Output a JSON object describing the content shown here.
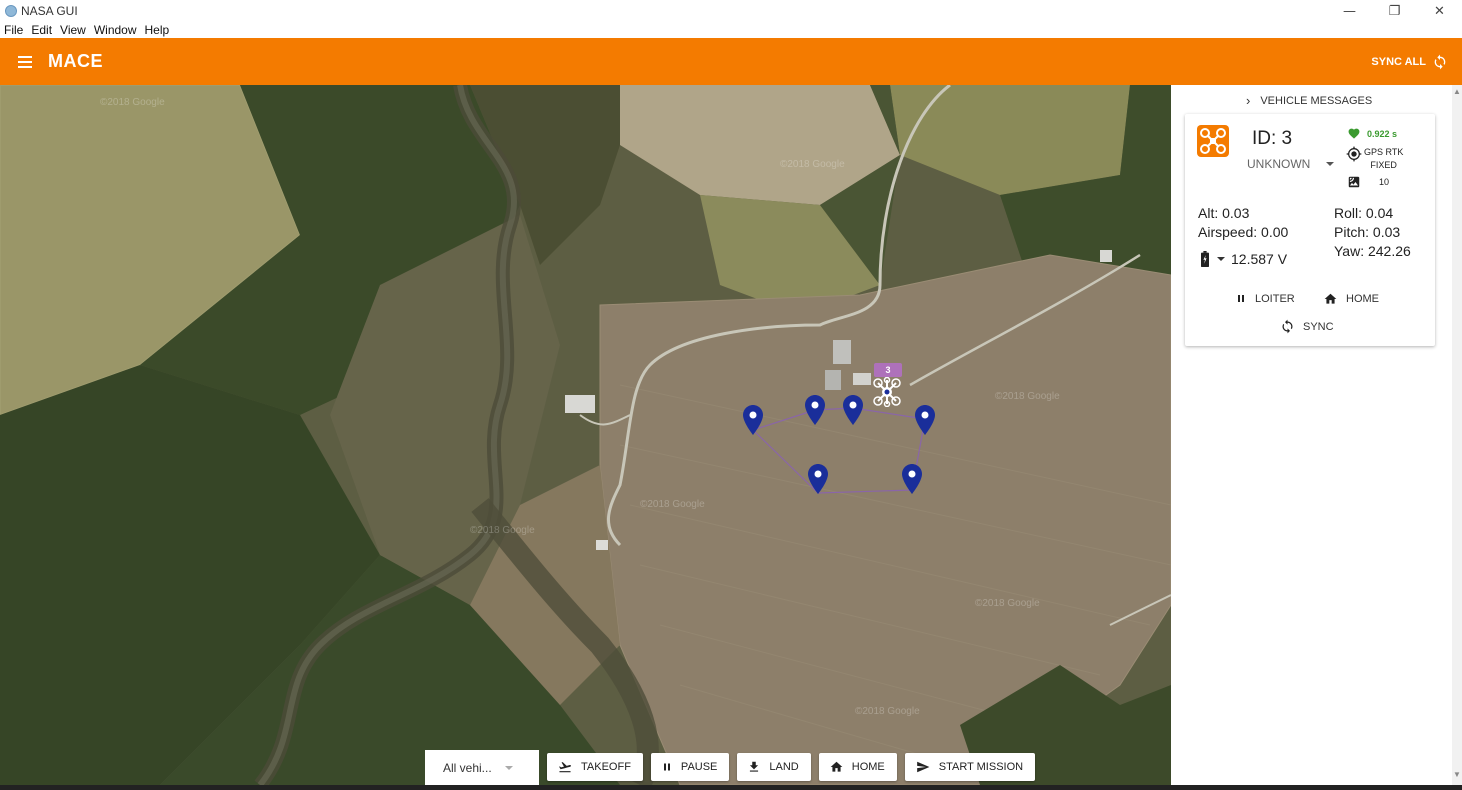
{
  "window": {
    "title": "NASA GUI",
    "controls": [
      "—",
      "❐",
      "✕"
    ]
  },
  "menubar": [
    "File",
    "Edit",
    "View",
    "Window",
    "Help"
  ],
  "appbar": {
    "title": "MACE",
    "sync_all_label": "SYNC ALL"
  },
  "map": {
    "watermark": "©2018 Google",
    "vehicle_marker_label": "3",
    "mission_points": 6
  },
  "bottom_toolbar": {
    "vehicle_select": "All vehi...",
    "takeoff": "TAKEOFF",
    "pause": "PAUSE",
    "land": "LAND",
    "home": "HOME",
    "start_mission": "START MISSION"
  },
  "panel": {
    "header": "VEHICLE MESSAGES",
    "vehicle": {
      "id_label": "ID: 3",
      "mode": "UNKNOWN",
      "heartbeat": "0.922 s",
      "gps_line1": "GPS RTK",
      "gps_line2": "FIXED",
      "satellites": "10",
      "alt": "Alt: 0.03",
      "airspeed": "Airspeed: 0.00",
      "battery": "12.587 V",
      "roll": "Roll: 0.04",
      "pitch": "Pitch: 0.03",
      "yaw": "Yaw: 242.26",
      "loiter_label": "LOITER",
      "home_label": "HOME",
      "sync_label": "SYNC"
    }
  },
  "colors": {
    "accent": "#f47b00",
    "heartbeat": "#3a9a2f",
    "pin": "#1a2e9a"
  }
}
